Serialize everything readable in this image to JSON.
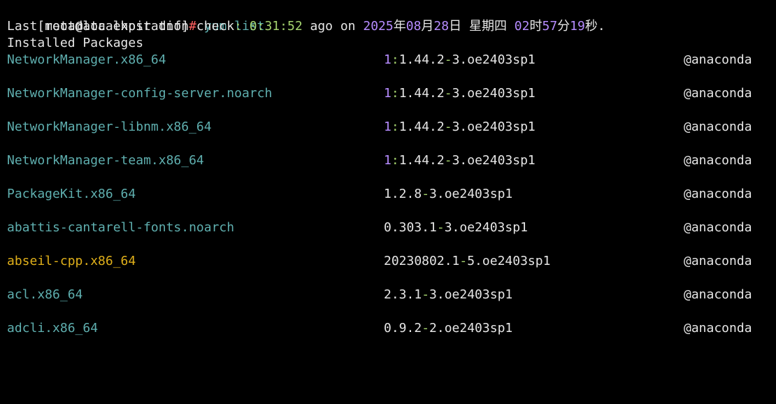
{
  "prompt": {
    "open_bracket": "[",
    "user_host": "root@localhost",
    "cwd": "dnf",
    "close_bracket": "]",
    "symbol": "#",
    "command": "yum list"
  },
  "metadata": {
    "label": "Last metadata expiration check",
    "colon": ":",
    "age": "0:31:52",
    "ago_on": "ago on",
    "year": "2025",
    "year_unit": "年",
    "month": "08",
    "month_unit": "月",
    "day": "28",
    "day_unit": "日",
    "weekday": "星期四",
    "hour": "02",
    "hour_unit": "时",
    "minute": "57",
    "minute_unit": "分",
    "second": "19",
    "second_unit": "秒",
    "end": "."
  },
  "section_heading": "Installed Packages",
  "packages": [
    {
      "name": "NetworkManager.x86_64",
      "name_color": "cyan",
      "epoch": "1",
      "version": "1.44.2",
      "release": "3.oe2403sp1",
      "repo": "@anaconda"
    },
    {
      "name": "NetworkManager-config-server.noarch",
      "name_color": "cyan",
      "epoch": "1",
      "version": "1.44.2",
      "release": "3.oe2403sp1",
      "repo": "@anaconda"
    },
    {
      "name": "NetworkManager-libnm.x86_64",
      "name_color": "cyan",
      "epoch": "1",
      "version": "1.44.2",
      "release": "3.oe2403sp1",
      "repo": "@anaconda"
    },
    {
      "name": "NetworkManager-team.x86_64",
      "name_color": "cyan",
      "epoch": "1",
      "version": "1.44.2",
      "release": "3.oe2403sp1",
      "repo": "@anaconda"
    },
    {
      "name": "PackageKit.x86_64",
      "name_color": "cyan",
      "epoch": "",
      "version": "1.2.8",
      "release": "3.oe2403sp1",
      "repo": "@anaconda"
    },
    {
      "name": "abattis-cantarell-fonts.noarch",
      "name_color": "cyan",
      "epoch": "",
      "version": "0.303.1",
      "release": "3.oe2403sp1",
      "repo": "@anaconda"
    },
    {
      "name": "abseil-cpp.x86_64",
      "name_color": "yellow",
      "epoch": "",
      "version": "20230802.1",
      "release": "5.oe2403sp1",
      "repo": "@anaconda"
    },
    {
      "name": "acl.x86_64",
      "name_color": "cyan",
      "epoch": "",
      "version": "2.3.1",
      "release": "3.oe2403sp1",
      "repo": "@anaconda"
    },
    {
      "name": "adcli.x86_64",
      "name_color": "cyan",
      "epoch": "",
      "version": "0.9.2",
      "release": "2.oe2403sp1",
      "repo": "@anaconda"
    }
  ],
  "colors": {
    "background": "#000000",
    "default": "#e6e6e6",
    "red": "#ff5f5f",
    "cyan": "#5fafaf",
    "green": "#a5d36f",
    "purple": "#b68cff",
    "yellow": "#e0b01a"
  }
}
